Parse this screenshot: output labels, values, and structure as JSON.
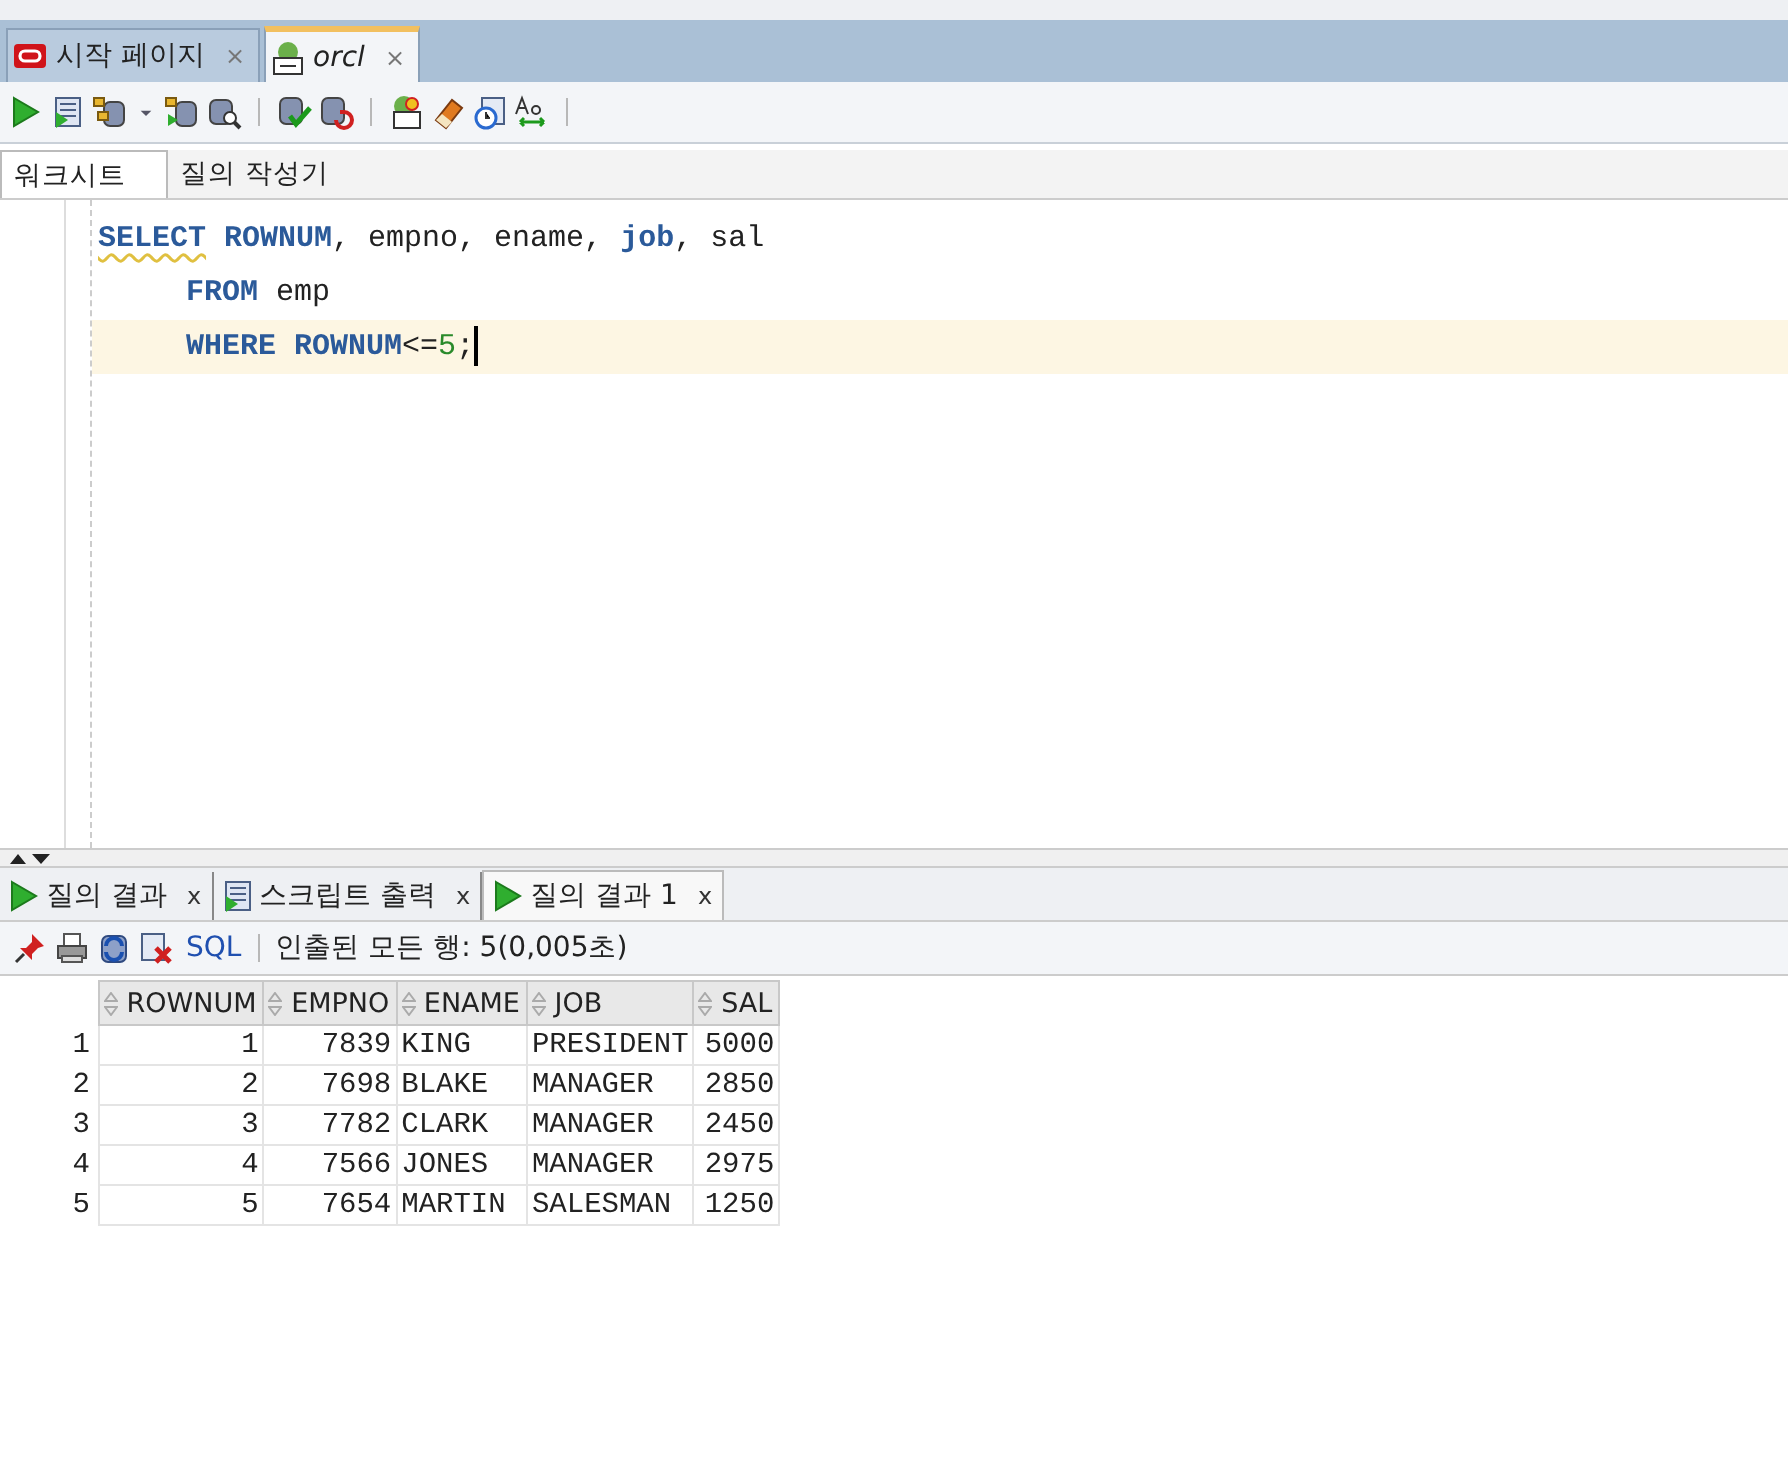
{
  "doc_tabs": [
    {
      "label": "시작 페이지",
      "kind": "oracle",
      "selected": false,
      "close": "×"
    },
    {
      "label": "orcl",
      "kind": "sql",
      "selected": true,
      "close": "×"
    }
  ],
  "toolbar": [
    {
      "kind": "run"
    },
    {
      "kind": "script"
    },
    {
      "kind": "commit"
    },
    {
      "kind": "dropdown"
    },
    {
      "kind": "explain"
    },
    {
      "kind": "autotrace"
    },
    {
      "kind": "sep"
    },
    {
      "kind": "check"
    },
    {
      "kind": "rollback"
    },
    {
      "kind": "sep"
    },
    {
      "kind": "sqlplus"
    },
    {
      "kind": "eraser"
    },
    {
      "kind": "history"
    },
    {
      "kind": "format"
    },
    {
      "kind": "sep"
    }
  ],
  "sub_tabs": [
    {
      "label": "워크시트",
      "selected": true
    },
    {
      "label": "질의 작성기",
      "selected": false
    }
  ],
  "editor": {
    "lines": [
      {
        "indented": false,
        "current": false,
        "tokens": [
          {
            "text": "SELECT",
            "kind": "keyword",
            "flagged": true
          },
          {
            "text": " ROWNUM",
            "kind": "keyword",
            "flagged": false
          },
          {
            "text": ", empno, ename, ",
            "kind": "plain",
            "flagged": false
          },
          {
            "text": "job",
            "kind": "keyword",
            "flagged": false
          },
          {
            "text": ", sal",
            "kind": "plain",
            "flagged": false
          }
        ]
      },
      {
        "indented": true,
        "current": false,
        "tokens": [
          {
            "text": "FROM",
            "kind": "keyword",
            "flagged": false
          },
          {
            "text": " emp",
            "kind": "plain",
            "flagged": false
          }
        ]
      },
      {
        "indented": true,
        "current": true,
        "tokens": [
          {
            "text": "WHERE",
            "kind": "keyword",
            "flagged": false
          },
          {
            "text": " ROWNUM",
            "kind": "keyword",
            "flagged": false
          },
          {
            "text": "<=",
            "kind": "plain",
            "flagged": false
          },
          {
            "text": "5",
            "kind": "number",
            "flagged": false
          },
          {
            "text": ";",
            "kind": "plain",
            "flagged": false
          }
        ]
      }
    ]
  },
  "result_tabs": [
    {
      "label": "질의 결과",
      "kind": "run",
      "selected": false,
      "close": "x"
    },
    {
      "label": "스크립트 출력",
      "kind": "script",
      "selected": false,
      "close": "x"
    },
    {
      "label": "질의 결과 1",
      "kind": "run",
      "selected": true,
      "close": "x"
    }
  ],
  "result_toolbar": {
    "buttons": [
      {
        "kind": "pin"
      },
      {
        "kind": "print"
      },
      {
        "kind": "refresh"
      },
      {
        "kind": "delete"
      }
    ],
    "sql_label": "SQL",
    "status": "인출된 모든 행: 5(0,005초)"
  },
  "table": {
    "columns": [
      "",
      "ROWNUM",
      "EMPNO",
      "ENAME",
      "JOB",
      "SAL"
    ],
    "rows": [
      [
        "1",
        "1",
        "7839",
        "KING",
        "PRESIDENT",
        "5000"
      ],
      [
        "2",
        "2",
        "7698",
        "BLAKE",
        "MANAGER",
        "2850"
      ],
      [
        "3",
        "3",
        "7782",
        "CLARK",
        "MANAGER",
        "2450"
      ],
      [
        "4",
        "4",
        "7566",
        "JONES",
        "MANAGER",
        "2975"
      ],
      [
        "5",
        "5",
        "7654",
        "MARTIN",
        "SALESMAN",
        "1250"
      ]
    ]
  }
}
